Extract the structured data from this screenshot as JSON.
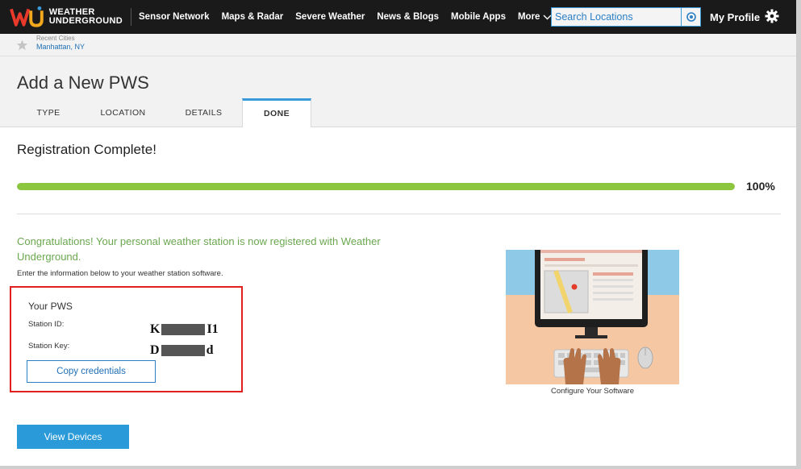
{
  "brand": {
    "name_line1": "WEATHER",
    "name_line2": "UNDERGROUND",
    "logo_mark": "wu"
  },
  "nav": {
    "items": [
      "Sensor Network",
      "Maps & Radar",
      "Severe Weather",
      "News & Blogs",
      "Mobile Apps"
    ],
    "more_label": "More",
    "search_placeholder": "Search Locations",
    "profile_label": "My Profile"
  },
  "recent": {
    "label": "Recent Cities",
    "city": "Manhattan, NY"
  },
  "page": {
    "title": "Add a New PWS",
    "tabs": [
      {
        "label": "TYPE",
        "active": false
      },
      {
        "label": "LOCATION",
        "active": false
      },
      {
        "label": "DETAILS",
        "active": false
      },
      {
        "label": "DONE",
        "active": true
      }
    ]
  },
  "registration": {
    "title": "Registration Complete!",
    "progress_fraction": 1.0,
    "progress_label": "100%",
    "congrats": "Congratulations! Your personal weather station is now registered with Weather Underground.",
    "instructions": "Enter the information below to your weather station software.",
    "pws_title": "Your PWS",
    "station_id_label": "Station ID:",
    "station_id_prefix": "K",
    "station_id_suffix": "I1",
    "station_key_label": "Station Key:",
    "station_key_prefix": "D",
    "station_key_suffix": "d",
    "copy_button": "Copy credentials",
    "view_devices_button": "View Devices",
    "illustration_caption": "Configure Your Software"
  },
  "colors": {
    "topbar": "#1a1a1a",
    "accent": "#2a9ad9",
    "progress": "#8cc63f",
    "congrats_text": "#6aa84f",
    "highlight_box": "#e02020"
  }
}
